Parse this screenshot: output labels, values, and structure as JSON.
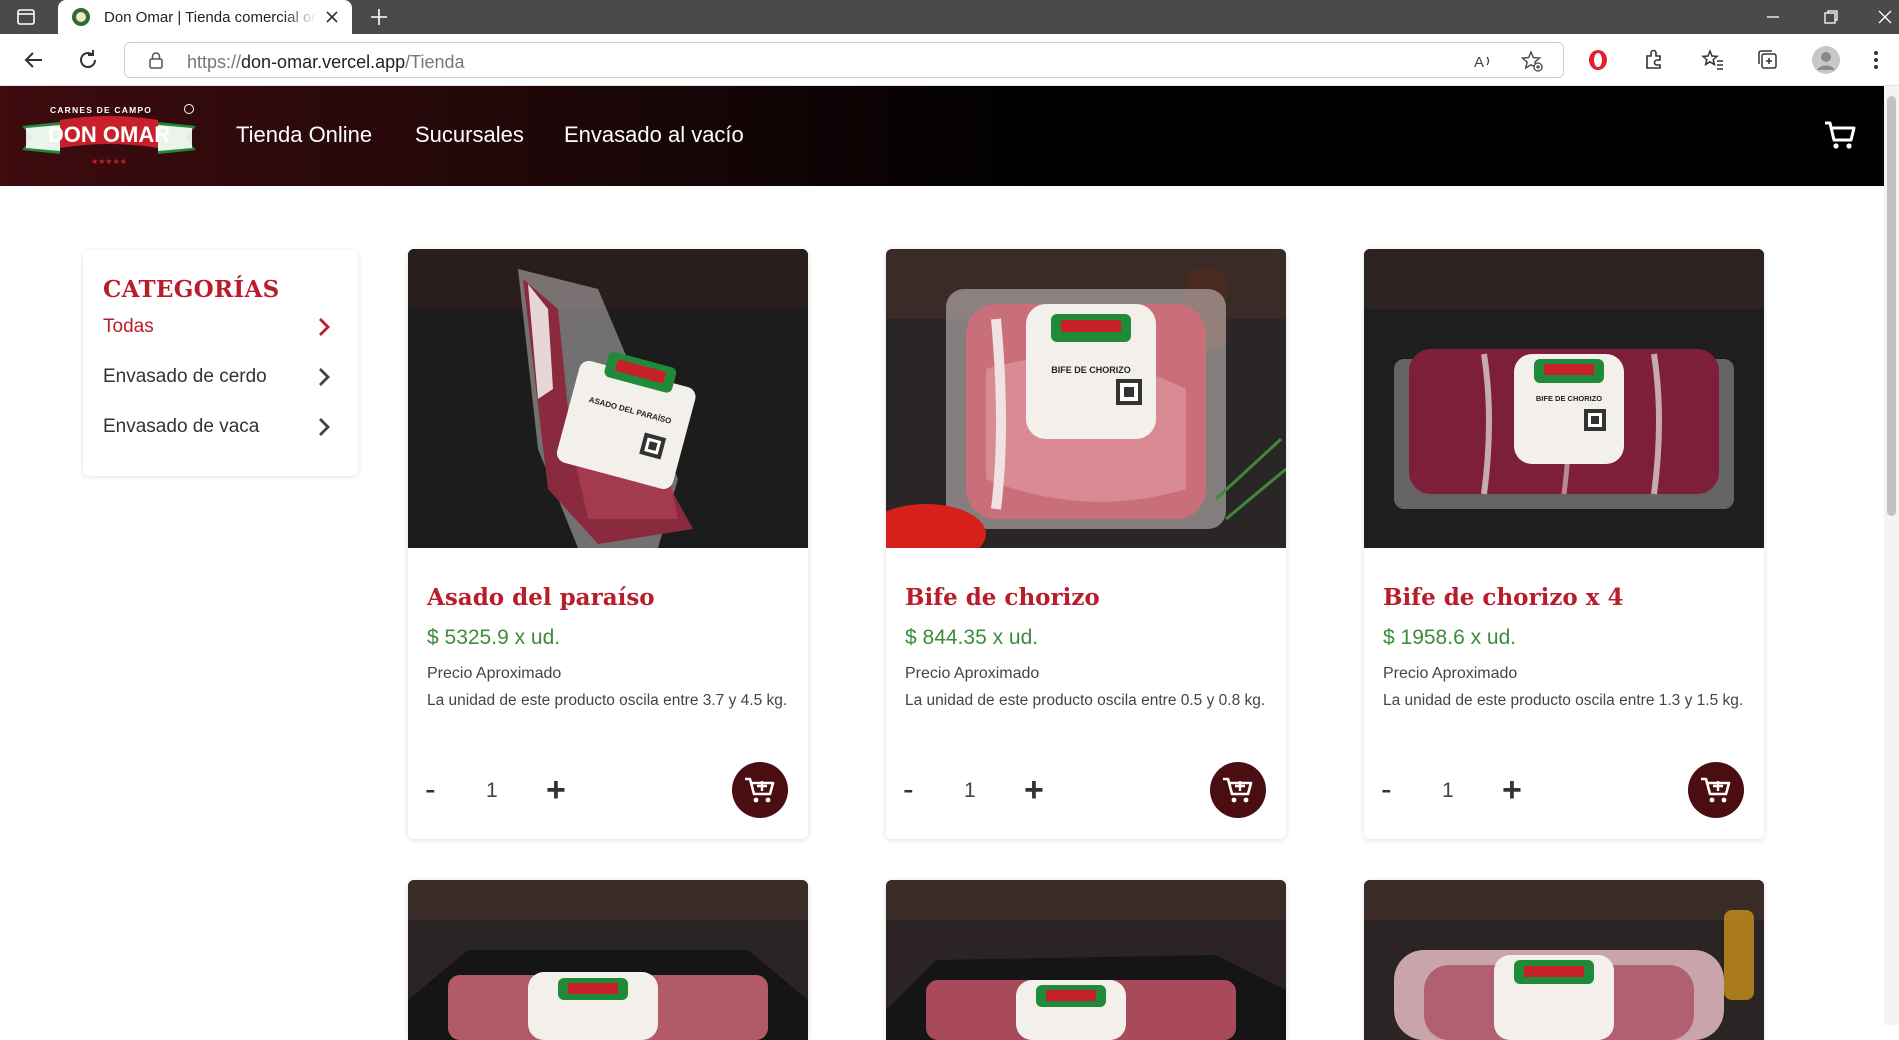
{
  "browser": {
    "tab_title": "Don Omar | Tienda comercial online",
    "url_prefix": "https://",
    "url_host": "don-omar.vercel.app",
    "url_path": "/Tienda"
  },
  "header": {
    "logo_top_text": "CARNES DE CAMPO",
    "logo_main_text": "DON OMAR",
    "nav": [
      {
        "label": "Tienda Online"
      },
      {
        "label": "Sucursales"
      },
      {
        "label": "Envasado al vacío"
      }
    ],
    "cart_icon": "cart-icon"
  },
  "sidebar": {
    "title": "CATEGORÍAS",
    "items": [
      {
        "label": "Todas",
        "active": true
      },
      {
        "label": "Envasado de cerdo",
        "active": false
      },
      {
        "label": "Envasado de vaca",
        "active": false
      }
    ]
  },
  "products": [
    {
      "name": "Asado del paraíso",
      "price": "$ 5325.9 x ud.",
      "approx": "Precio Aproximado",
      "desc": "La unidad de este producto oscila entre 3.7 y 4.5 kg.",
      "qty": "1",
      "label_text": "ASADO DEL PARAÍSO"
    },
    {
      "name": "Bife de chorizo",
      "price": "$ 844.35 x ud.",
      "approx": "Precio Aproximado",
      "desc": "La unidad de este producto oscila entre 0.5 y 0.8 kg.",
      "qty": "1",
      "label_text": "BIFE DE CHORIZO"
    },
    {
      "name": "Bife de chorizo x 4",
      "price": "$ 1958.6 x ud.",
      "approx": "Precio Aproximado",
      "desc": "La unidad de este producto oscila entre 1.3 y 1.5 kg.",
      "qty": "1",
      "label_text": "BIFE DE CHORIZO"
    }
  ],
  "controls": {
    "minus": "-",
    "plus": "+"
  },
  "colors": {
    "brand_red": "#b91d2b",
    "price_green": "#3d8b3d",
    "cart_button": "#4a0d12",
    "header_dark": "#000000"
  }
}
